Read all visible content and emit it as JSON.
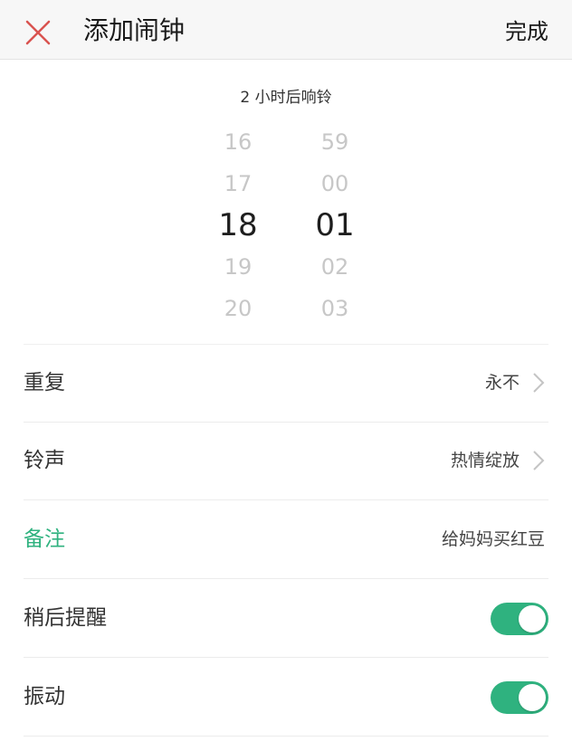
{
  "header": {
    "title": "添加闹钟",
    "done_label": "完成",
    "close_icon": "close-icon",
    "close_color": "#d9534f"
  },
  "picker": {
    "hint": "2 小时后响铃",
    "hours": [
      "16",
      "17",
      "18",
      "19",
      "20"
    ],
    "minutes": [
      "59",
      "00",
      "01",
      "02",
      "03"
    ],
    "selected_hour": "18",
    "selected_minute": "01"
  },
  "settings": {
    "repeat": {
      "label": "重复",
      "value": "永不"
    },
    "ringtone": {
      "label": "铃声",
      "value": "热情绽放"
    },
    "note": {
      "label": "备注",
      "value": "给妈妈买红豆"
    },
    "snooze": {
      "label": "稍后提醒",
      "enabled": true
    },
    "vibrate": {
      "label": "振动",
      "enabled": true
    }
  },
  "colors": {
    "accent": "#2fb27f",
    "toggle_on": "#2fb27f"
  }
}
